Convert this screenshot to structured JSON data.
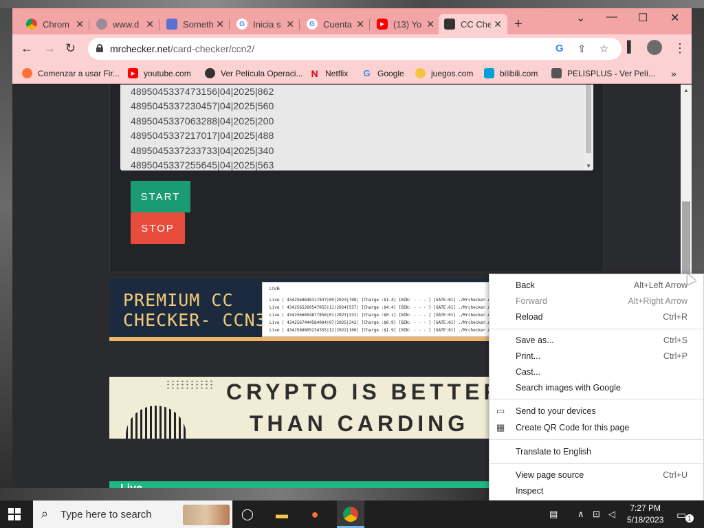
{
  "browser": {
    "tabs": [
      {
        "label": "Chrom",
        "icon": "chrome-icon"
      },
      {
        "label": "www.d",
        "icon": "globe-icon"
      },
      {
        "label": "Someth",
        "icon": "flask-icon"
      },
      {
        "label": "Inicia s",
        "icon": "google-icon"
      },
      {
        "label": "Cuenta",
        "icon": "google-icon"
      },
      {
        "label": "(13) Yo",
        "icon": "youtube-icon"
      },
      {
        "label": "CC Che",
        "icon": "site-icon",
        "active": true
      }
    ],
    "url": {
      "host": "mrchecker.net",
      "path": "/card-checker/ccn2/"
    },
    "bookmarks": [
      {
        "label": "Comenzar a usar Fir...",
        "icon": "firefox-icon"
      },
      {
        "label": "youtube.com",
        "icon": "youtube-icon"
      },
      {
        "label": "Ver Película Operaci...",
        "icon": "spider-icon"
      },
      {
        "label": "Netflix",
        "icon": "netflix-icon"
      },
      {
        "label": "Google",
        "icon": "google-icon"
      },
      {
        "label": "juegos.com",
        "icon": "games-icon"
      },
      {
        "label": "bilibili.com",
        "icon": "bilibili-icon"
      },
      {
        "label": "PELISPLUS - Ver Pelí...",
        "icon": "film-icon"
      }
    ]
  },
  "checker": {
    "cards": [
      "4895045337473156|04|2025|862",
      "4895045337230457|04|2025|560",
      "4895045337063288|04|2025|200",
      "4895045337217017|04|2025|488",
      "4895045337233733|04|2025|340",
      "4895045337255645|04|2025|563"
    ],
    "start_label": "START",
    "stop_label": "STOP"
  },
  "banners": {
    "premium_line1": "PREMIUM CC",
    "premium_line2": "CHECKER- CCN3",
    "live_badge": "LIVE",
    "log_lines": [
      "Live | 4342568648317837|09|2023|708| [Charge :$1.4] [BIN: - - - ] [GATE:01] ./Mrchecker.net",
      "Live | 4342565260547055|11|2024|557| [Charge :$4.4] [BIN: - - - ] [GATE:01] ./Mrchecker.net",
      "Live | 4342566854877858|01|2023|332| [Charge :$0.1] [BIN: - - - ] [GATE:01] ./Mrchecker.net",
      "Live | 4342567444584004|07|2025|342| [Charge :$0.9] [BIN: - - - ] [GATE:01] ./Mrchecker.net",
      "Live | 4342588605234355|12|2022|100| [Charge :$1.9] [BIN: - - - ] [GATE:01] ./Mrchecker.net"
    ],
    "crypto_line1": "CRYPTO IS BETTER",
    "crypto_line2": "THAN CARDING",
    "live_bar": "Live"
  },
  "context_menu": {
    "items": [
      {
        "label": "Back",
        "shortcut": "Alt+Left Arrow"
      },
      {
        "label": "Forward",
        "shortcut": "Alt+Right Arrow"
      },
      {
        "label": "Reload",
        "shortcut": "Ctrl+R"
      },
      {
        "label": "Save as...",
        "shortcut": "Ctrl+S"
      },
      {
        "label": "Print...",
        "shortcut": "Ctrl+P"
      },
      {
        "label": "Cast...",
        "shortcut": ""
      },
      {
        "label": "Search images with Google",
        "shortcut": ""
      },
      {
        "label": "Send to your devices",
        "shortcut": ""
      },
      {
        "label": "Create QR Code for this page",
        "shortcut": ""
      },
      {
        "label": "Translate to English",
        "shortcut": ""
      },
      {
        "label": "View page source",
        "shortcut": "Ctrl+U"
      },
      {
        "label": "Inspect",
        "shortcut": ""
      }
    ]
  },
  "taskbar": {
    "search_placeholder": "Type here to search",
    "time": "7:27 PM",
    "date": "5/18/2023",
    "notification_count": "1"
  },
  "colors": {
    "tab_bar": "#f3a5a6",
    "toolbar": "#fbd1d2",
    "start_button": "#1a9b72",
    "stop_button": "#e74c3c",
    "live_green": "#1fb885",
    "banner_gold": "#f3cc7a"
  }
}
